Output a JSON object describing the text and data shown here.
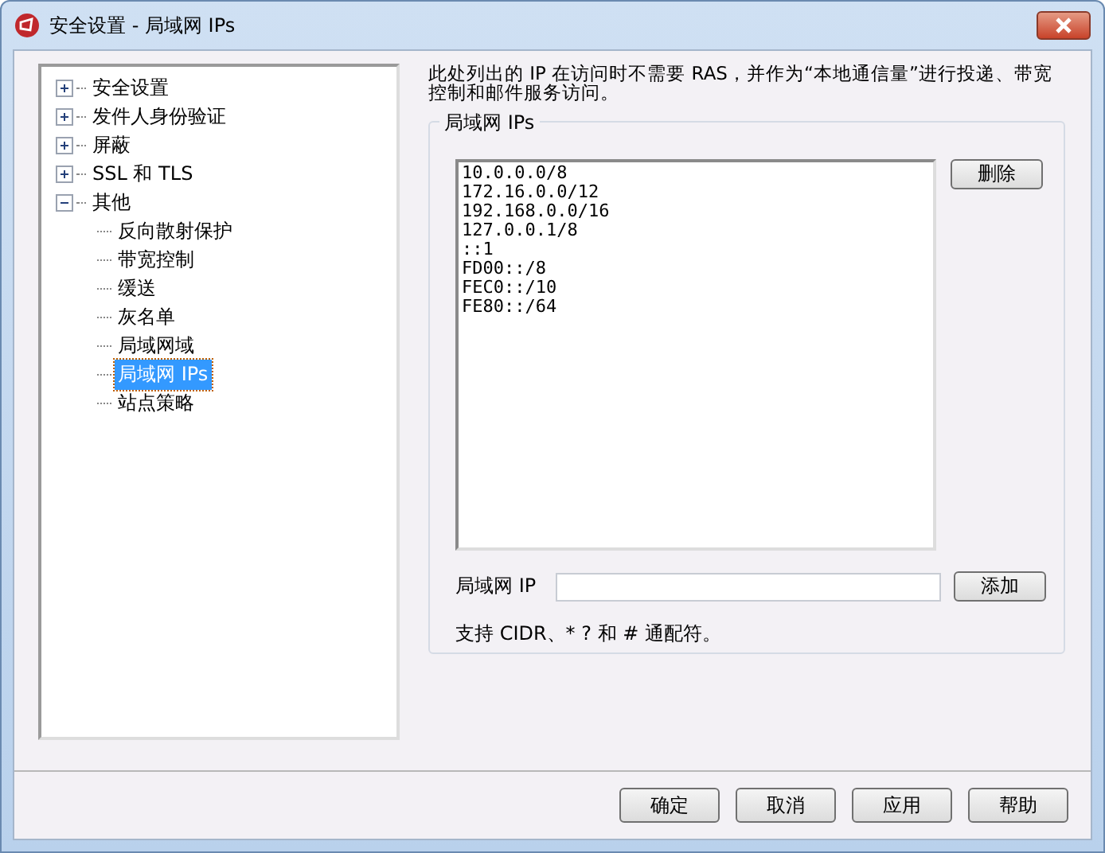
{
  "window": {
    "title": "安全设置 - 局域网 IPs"
  },
  "tree": [
    {
      "label": "安全设置",
      "expanded": false,
      "selected": false
    },
    {
      "label": "发件人身份验证",
      "expanded": false,
      "selected": false
    },
    {
      "label": "屏蔽",
      "expanded": false,
      "selected": false
    },
    {
      "label": "SSL 和 TLS",
      "expanded": false,
      "selected": false
    },
    {
      "label": "其他",
      "expanded": true,
      "selected": false,
      "children": [
        {
          "label": "反向散射保护",
          "selected": false
        },
        {
          "label": "带宽控制",
          "selected": false
        },
        {
          "label": "缓送",
          "selected": false
        },
        {
          "label": "灰名单",
          "selected": false
        },
        {
          "label": "局域网域",
          "selected": false
        },
        {
          "label": "局域网 IPs",
          "selected": true
        },
        {
          "label": "站点策略",
          "selected": false
        }
      ]
    }
  ],
  "description": "此处列出的 IP 在访问时不需要 RAS，并作为“本地通信量”进行投递、带宽控制和邮件服务访问。",
  "group": {
    "title": "局域网 IPs",
    "list": [
      "10.0.0.0/8",
      "172.16.0.0/12",
      "192.168.0.0/16",
      "127.0.0.1/8",
      "::1",
      "FD00::/8",
      "FEC0::/10",
      "FE80::/64"
    ],
    "remove_button": "删除",
    "field_label": "局域网 IP",
    "add_button": "添加",
    "hint": "支持 CIDR、* ? 和 # 通配符。"
  },
  "buttons": [
    "确定",
    "取消",
    "应用",
    "帮助"
  ]
}
